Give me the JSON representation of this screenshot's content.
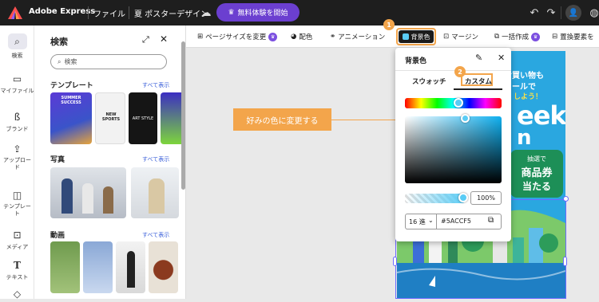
{
  "header": {
    "app_name": "Adobe Express",
    "file_menu": "ファイル",
    "doc_title": "夏 ポスターデザイン",
    "trial_button": "無料体験を開始"
  },
  "rail": {
    "items": [
      {
        "label": "検索",
        "icon": "search-icon"
      },
      {
        "label": "マイファイル",
        "icon": "folder-icon"
      },
      {
        "label": "ブランド",
        "icon": "brand-icon"
      },
      {
        "label": "アップロード",
        "icon": "upload-icon"
      },
      {
        "label": "テンプレート",
        "icon": "template-icon"
      },
      {
        "label": "メディア",
        "icon": "media-icon"
      },
      {
        "label": "テキスト",
        "icon": "text-icon"
      }
    ]
  },
  "panel": {
    "title": "検索",
    "search_placeholder": "検索",
    "sections": {
      "templates": "テンプレート",
      "photos": "写真",
      "videos": "動画"
    },
    "see_all": "すべて表示",
    "template_thumb_texts": [
      "SUMMER SUCCESS",
      "NEW SPORTS",
      "ART STYLE"
    ]
  },
  "toolbar": {
    "page_size": "ページサイズを変更",
    "color": "配色",
    "animation": "アニメーション",
    "background": "背景色",
    "margin": "マージン",
    "batch": "一括作成",
    "replace": "置換要素を"
  },
  "badges": {
    "one": "1",
    "two": "2"
  },
  "callout": {
    "text": "好みの色に変更する"
  },
  "popup": {
    "title": "背景色",
    "tab_swatch": "スウォッチ",
    "tab_custom": "カスタム",
    "opacity": "100%",
    "format": "16 進",
    "hex": "#5ACCF5"
  },
  "poster": {
    "line1": "お買い物も",
    "line2": "ールで",
    "line3": "しよう！",
    "big": "eek",
    "big2": "n",
    "badge_line1": "抽選で",
    "badge_line2": "商品券",
    "badge_line3": "当たる"
  },
  "colors": {
    "accent": "#f3a54b",
    "brand": "#6b3fd0",
    "poster_bg": "#2aa7e0",
    "selected_color": "#5ACCF5"
  }
}
